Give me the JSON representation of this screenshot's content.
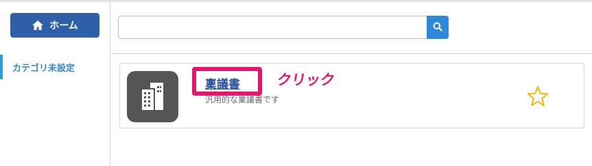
{
  "sidebar": {
    "home_label": "ホーム",
    "home_icon": "home-icon",
    "categories": [
      {
        "label": "カテゴリ未設定",
        "active": true
      }
    ]
  },
  "search": {
    "value": "",
    "placeholder": "",
    "icon": "search-icon"
  },
  "card": {
    "title": "稟議書",
    "description": "汎用的な稟議書です",
    "icon": "building-icon",
    "favorite_icon": "star-icon",
    "annotation": "クリック"
  },
  "colors": {
    "home_button": "#2e5fa8",
    "accent": "#2e8ad8",
    "highlight": "#e8156b",
    "star": "#f5b800",
    "icon_bg": "#555555"
  }
}
